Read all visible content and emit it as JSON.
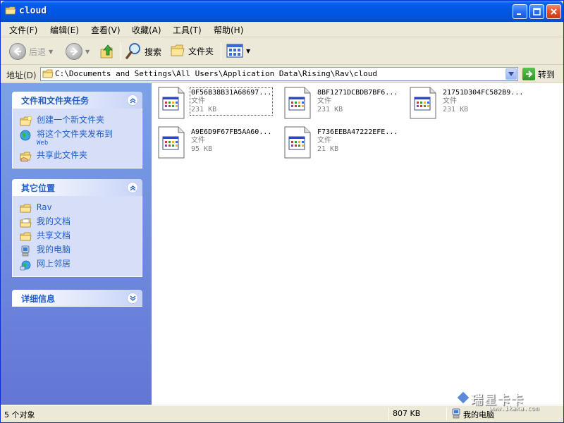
{
  "window": {
    "title": "cloud"
  },
  "menu": {
    "items": [
      "文件(F)",
      "编辑(E)",
      "查看(V)",
      "收藏(A)",
      "工具(T)",
      "帮助(H)"
    ]
  },
  "toolbar": {
    "back_label": "后退",
    "search_label": "搜索",
    "folders_label": "文件夹"
  },
  "address": {
    "label": "地址(D)",
    "value": "C:\\Documents and Settings\\All Users\\Application Data\\Rising\\Rav\\cloud",
    "go_label": "转到"
  },
  "sidebar": {
    "tasks": {
      "title": "文件和文件夹任务",
      "items": [
        {
          "label": "创建一个新文件夹",
          "icon": "new-folder-icon"
        },
        {
          "label": "将这个文件夹发布到",
          "sub": "Web",
          "icon": "publish-web-icon"
        },
        {
          "label": "共享此文件夹",
          "icon": "share-folder-icon"
        }
      ]
    },
    "places": {
      "title": "其它位置",
      "items": [
        {
          "label": "Rav",
          "icon": "folder-icon"
        },
        {
          "label": "我的文档",
          "icon": "my-documents-icon"
        },
        {
          "label": "共享文档",
          "icon": "shared-documents-icon"
        },
        {
          "label": "我的电脑",
          "icon": "my-computer-icon"
        },
        {
          "label": "网上邻居",
          "icon": "network-places-icon"
        }
      ]
    },
    "details": {
      "title": "详细信息"
    }
  },
  "files": [
    {
      "name": "0F56B38B31A68697...",
      "type": "文件",
      "size": "231 KB",
      "selected": true
    },
    {
      "name": "8BF1271DCBDB7BF6...",
      "type": "文件",
      "size": "231 KB"
    },
    {
      "name": "21751D304FC582B9...",
      "type": "文件",
      "size": "231 KB"
    },
    {
      "name": "A9E6D9F67FB5AA60...",
      "type": "文件",
      "size": "95 KB"
    },
    {
      "name": "F736EEBA47222EFE...",
      "type": "文件",
      "size": "21 KB"
    }
  ],
  "status": {
    "count": "5 个对象",
    "total_size": "807 KB",
    "location": "我的电脑"
  },
  "watermark": {
    "brand": "瑞星卡卡",
    "url": "www.ikaka.com"
  },
  "colors": {
    "titlebar": "#0054e3",
    "sidebar_gradient_top": "#7ba2e7",
    "sidebar_gradient_bottom": "#6375d6",
    "task_link": "#215dc6"
  }
}
